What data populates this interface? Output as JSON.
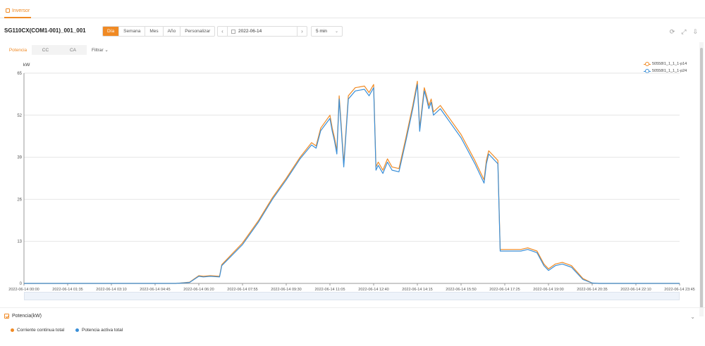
{
  "tab": {
    "label": "Inversor"
  },
  "device": {
    "name": "SG110CX(COM1-001)_001_001"
  },
  "period_buttons": [
    {
      "label": "Día",
      "active": true
    },
    {
      "label": "Semana",
      "active": false
    },
    {
      "label": "Mes",
      "active": false
    },
    {
      "label": "Año",
      "active": false
    },
    {
      "label": "Personalizar",
      "active": false
    }
  ],
  "date": {
    "value": "2022-06-14"
  },
  "interval": {
    "value": "5 min"
  },
  "subtabs": [
    {
      "label": "Potencia",
      "active": true
    },
    {
      "label": "CC",
      "active": false
    },
    {
      "label": "CA",
      "active": false
    }
  ],
  "filter": {
    "label": "Filtrar"
  },
  "colors": {
    "accent": "#f08a24",
    "series1": "#f08a24",
    "series2": "#3a8fd8"
  },
  "panel": {
    "title": "Potencia(kW)",
    "series": [
      {
        "label": "Corriente continua total",
        "color": "#f08a24"
      },
      {
        "label": "Potencia activa total",
        "color": "#3a8fd8"
      }
    ]
  },
  "chart_data": {
    "type": "line",
    "ylabel": "kW",
    "ylim": [
      0,
      65
    ],
    "yticks": [
      0,
      13,
      26,
      39,
      52,
      65
    ],
    "xlim": [
      "2022-06-14 00:00",
      "2022-06-14 23:45"
    ],
    "xticks": [
      "2022-06-14 00:00",
      "2022-06-14 01:35",
      "2022-06-14 03:10",
      "2022-06-14 04:45",
      "2022-06-14 06:20",
      "2022-06-14 07:55",
      "2022-06-14 09:30",
      "2022-06-14 11:05",
      "2022-06-14 12:40",
      "2022-06-14 14:15",
      "2022-06-14 15:50",
      "2022-06-14 17:25",
      "2022-06-14 19:00",
      "2022-06-14 20:35",
      "2022-06-14 22:10",
      "2022-06-14 23:45"
    ],
    "grid": true,
    "legend": "top-right",
    "x": [
      "2022-06-14 00:00",
      "2022-06-14 05:30",
      "2022-06-14 06:00",
      "2022-06-14 06:20",
      "2022-06-14 06:30",
      "2022-06-14 06:45",
      "2022-06-14 07:05",
      "2022-06-14 07:10",
      "2022-06-14 07:30",
      "2022-06-14 07:55",
      "2022-06-14 08:30",
      "2022-06-14 09:00",
      "2022-06-14 09:30",
      "2022-06-14 10:00",
      "2022-06-14 10:25",
      "2022-06-14 10:35",
      "2022-06-14 10:45",
      "2022-06-14 11:05",
      "2022-06-14 11:10",
      "2022-06-14 11:15",
      "2022-06-14 11:20",
      "2022-06-14 11:25",
      "2022-06-14 11:30",
      "2022-06-14 11:35",
      "2022-06-14 11:45",
      "2022-06-14 12:00",
      "2022-06-14 12:20",
      "2022-06-14 12:30",
      "2022-06-14 12:40",
      "2022-06-14 12:45",
      "2022-06-14 12:50",
      "2022-06-14 13:00",
      "2022-06-14 13:10",
      "2022-06-14 13:20",
      "2022-06-14 13:35",
      "2022-06-14 13:50",
      "2022-06-14 14:05",
      "2022-06-14 14:15",
      "2022-06-14 14:20",
      "2022-06-14 14:30",
      "2022-06-14 14:35",
      "2022-06-14 14:40",
      "2022-06-14 14:45",
      "2022-06-14 14:50",
      "2022-06-14 15:05",
      "2022-06-14 15:20",
      "2022-06-14 15:50",
      "2022-06-14 16:20",
      "2022-06-14 16:40",
      "2022-06-14 16:45",
      "2022-06-14 16:50",
      "2022-06-14 17:10",
      "2022-06-14 17:15",
      "2022-06-14 17:25",
      "2022-06-14 18:00",
      "2022-06-14 18:15",
      "2022-06-14 18:35",
      "2022-06-14 18:50",
      "2022-06-14 19:00",
      "2022-06-14 19:15",
      "2022-06-14 19:30",
      "2022-06-14 19:50",
      "2022-06-14 20:15",
      "2022-06-14 20:35",
      "2022-06-14 20:50",
      "2022-06-14 23:45"
    ],
    "series": [
      {
        "name": "50558I1_1_1_1-p14",
        "values": [
          0,
          0,
          0.4,
          2.4,
          2.2,
          2.4,
          2.2,
          5.8,
          8.8,
          12.5,
          19.5,
          26.5,
          32.5,
          39,
          43.5,
          42.5,
          48,
          52,
          48,
          45,
          41,
          58,
          48,
          37,
          58,
          60.5,
          61,
          59,
          61.5,
          36,
          37.5,
          35,
          38.5,
          36,
          35.5,
          45,
          55,
          62.5,
          48,
          60.5,
          58,
          55,
          57,
          53,
          55,
          52,
          46,
          38,
          32,
          38,
          41,
          38,
          10.5,
          10.5,
          10.5,
          11,
          10,
          6,
          4.5,
          6,
          6.5,
          5.5,
          1.5,
          0.1,
          0,
          0
        ]
      },
      {
        "name": "50558I1_1_1_1-p24",
        "values": [
          0,
          0,
          0.3,
          2.2,
          2.0,
          2.2,
          2.0,
          5.5,
          8.4,
          12,
          19,
          26,
          32,
          38.5,
          42.8,
          41.8,
          47.2,
          51,
          47,
          44,
          40,
          57,
          47,
          36,
          57,
          59.5,
          60,
          58,
          60.5,
          35,
          36.5,
          34,
          37.5,
          35,
          34.5,
          44,
          54,
          61.5,
          47,
          59.5,
          57,
          54,
          56,
          52,
          54,
          51,
          45,
          37,
          31,
          37,
          40,
          37,
          10,
          10,
          10,
          10.5,
          9.5,
          5.5,
          4,
          5.5,
          6,
          5,
          1.2,
          0.1,
          0,
          0
        ]
      }
    ]
  }
}
